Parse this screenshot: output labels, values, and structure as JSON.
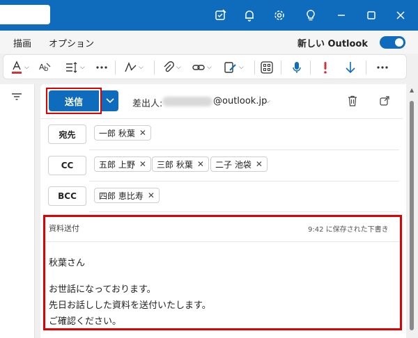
{
  "menu": {
    "draw": "描画",
    "options": "オプション",
    "new_outlook": "新しい Outlook"
  },
  "compose": {
    "send_label": "送信",
    "from_label": "差出人:",
    "from_domain": "@outlook.jp",
    "to_label": "宛先",
    "cc_label": "CC",
    "bcc_label": "BCC",
    "to_recipients": [
      "一郎 秋葉"
    ],
    "cc_recipients": [
      "五郎 上野",
      "三郎 秋葉",
      "二子 池袋"
    ],
    "bcc_recipients": [
      "四郎 恵比寿"
    ],
    "subject": "資料送付",
    "saved_status": "9:42 に保存された下書き",
    "body_lines": [
      "秋葉さん",
      "お世話になっております。",
      "先日お話しした資料を送付いたします。",
      "ご確認ください。"
    ]
  },
  "colors": {
    "brand": "#0f6cbd",
    "highlight": "#e00000"
  }
}
